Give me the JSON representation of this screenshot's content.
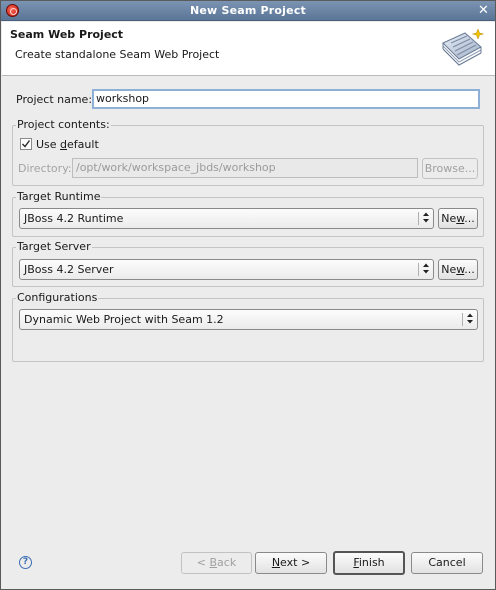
{
  "window": {
    "title": "New Seam Project"
  },
  "banner": {
    "heading": "Seam Web Project",
    "description": "Create standalone Seam Web Project"
  },
  "project_name": {
    "label": "Project name:",
    "value": "workshop"
  },
  "project_contents": {
    "group_label": "Project contents:",
    "use_default": {
      "label_pre": "Use ",
      "label_mnemonic": "d",
      "label_post": "efault",
      "checked": true
    },
    "directory": {
      "label": "Directory:",
      "value": "/opt/work/workspace_jbds/workshop"
    },
    "browse_label": "Browse..."
  },
  "target_runtime": {
    "group_label": "Target Runtime",
    "selected": "JBoss 4.2 Runtime",
    "new_pre": "Ne",
    "new_mnemonic": "w",
    "new_post": "..."
  },
  "target_server": {
    "group_label": "Target Server",
    "selected": "JBoss 4.2 Server",
    "new_pre": "Ne",
    "new_mnemonic": "w",
    "new_post": "..."
  },
  "configurations": {
    "group_label": "Configurations",
    "selected": "Dynamic Web Project with Seam 1.2"
  },
  "footer": {
    "back": {
      "pre": "< ",
      "mnemonic": "B",
      "post": "ack"
    },
    "next": {
      "pre": "",
      "mnemonic": "N",
      "post": "ext >"
    },
    "finish": {
      "pre": "",
      "mnemonic": "F",
      "post": "inish"
    },
    "cancel": "Cancel"
  }
}
